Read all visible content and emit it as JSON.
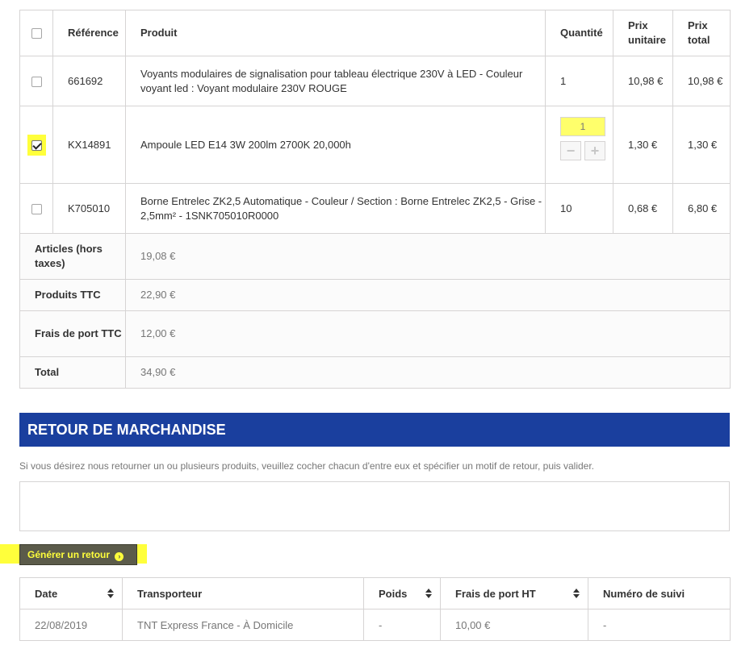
{
  "order_table": {
    "headers": {
      "reference": "Référence",
      "product": "Produit",
      "quantity": "Quantité",
      "unit_price": "Prix unitaire",
      "total_price": "Prix total"
    },
    "rows": [
      {
        "checked": false,
        "reference": "661692",
        "product": "Voyants modulaires de signalisation pour tableau électrique 230V à LED - Couleur voyant led : Voyant modulaire 230V ROUGE",
        "quantity": "1",
        "unit_price": "10,98 €",
        "total_price": "10,98 €"
      },
      {
        "checked": true,
        "reference": "KX14891",
        "product": "Ampoule LED E14 3W 200lm 2700K 20,000h",
        "quantity_input": "1",
        "quantity_minus": "−",
        "quantity_plus": "+",
        "unit_price": "1,30 €",
        "total_price": "1,30 €"
      },
      {
        "checked": false,
        "reference": "K705010",
        "product": "Borne Entrelec ZK2,5 Automatique - Couleur / Section : Borne Entrelec ZK2,5 - Grise - 2,5mm² - 1SNK705010R0000",
        "quantity": "10",
        "unit_price": "0,68 €",
        "total_price": "6,80 €"
      }
    ],
    "totals": [
      {
        "label": "Articles (hors taxes)",
        "value": "19,08 €"
      },
      {
        "label": "Produits TTC",
        "value": "22,90 €"
      },
      {
        "label": "Frais de port TTC",
        "value": "12,00 €"
      },
      {
        "label": "Total",
        "value": "34,90 €"
      }
    ]
  },
  "returns": {
    "title": "RETOUR DE MARCHANDISE",
    "intro": "Si vous désirez nous retourner un ou plusieurs produits, veuillez cocher chacun d'entre eux et spécifier un motif de retour, puis valider.",
    "motif_value": "",
    "button_label": "Générer un retour"
  },
  "shipping_table": {
    "headers": {
      "date": "Date",
      "carrier": "Transporteur",
      "weight": "Poids",
      "shipping_cost": "Frais de port HT",
      "tracking": "Numéro de suivi"
    },
    "rows": [
      {
        "date": "22/08/2019",
        "carrier": "TNT Express France - À Domicile",
        "weight": "-",
        "shipping_cost": "10,00 €",
        "tracking": "-"
      }
    ]
  },
  "colors": {
    "section_header_bg": "#1a3f9e",
    "highlight": "#ffff3b",
    "border": "#d6d4d4"
  }
}
